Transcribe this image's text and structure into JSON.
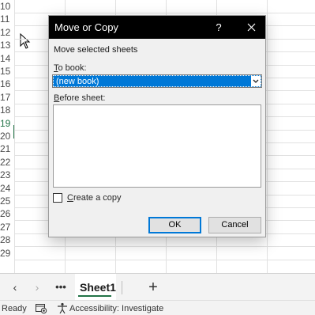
{
  "grid": {
    "row_numbers": [
      "10",
      "11",
      "12",
      "13",
      "14",
      "15",
      "16",
      "17",
      "18",
      "19",
      "20",
      "21",
      "22",
      "23",
      "24",
      "25",
      "26",
      "27",
      "28",
      "29"
    ],
    "active_row": "19"
  },
  "dialog": {
    "title": "Move or Copy",
    "help_label": "?",
    "close_icon": "close-icon",
    "subtitle": "Move selected sheets",
    "to_book_prefix": "T",
    "to_book_rest": "o book:",
    "to_book_value": "(new book)",
    "before_sheet_prefix": "B",
    "before_sheet_rest": "efore sheet:",
    "create_copy_prefix": "C",
    "create_copy_rest": "reate a copy",
    "create_copy_checked": false,
    "ok_label": "OK",
    "cancel_label": "Cancel",
    "accent_color": "#0078d7"
  },
  "sheet_tabs": {
    "prev_icon": "‹",
    "next_icon": "›",
    "more_label": "•••",
    "active_sheet": "Sheet1",
    "add_label": "+"
  },
  "status_bar": {
    "ready": "Ready",
    "accessibility": "Accessibility: Investigate"
  }
}
